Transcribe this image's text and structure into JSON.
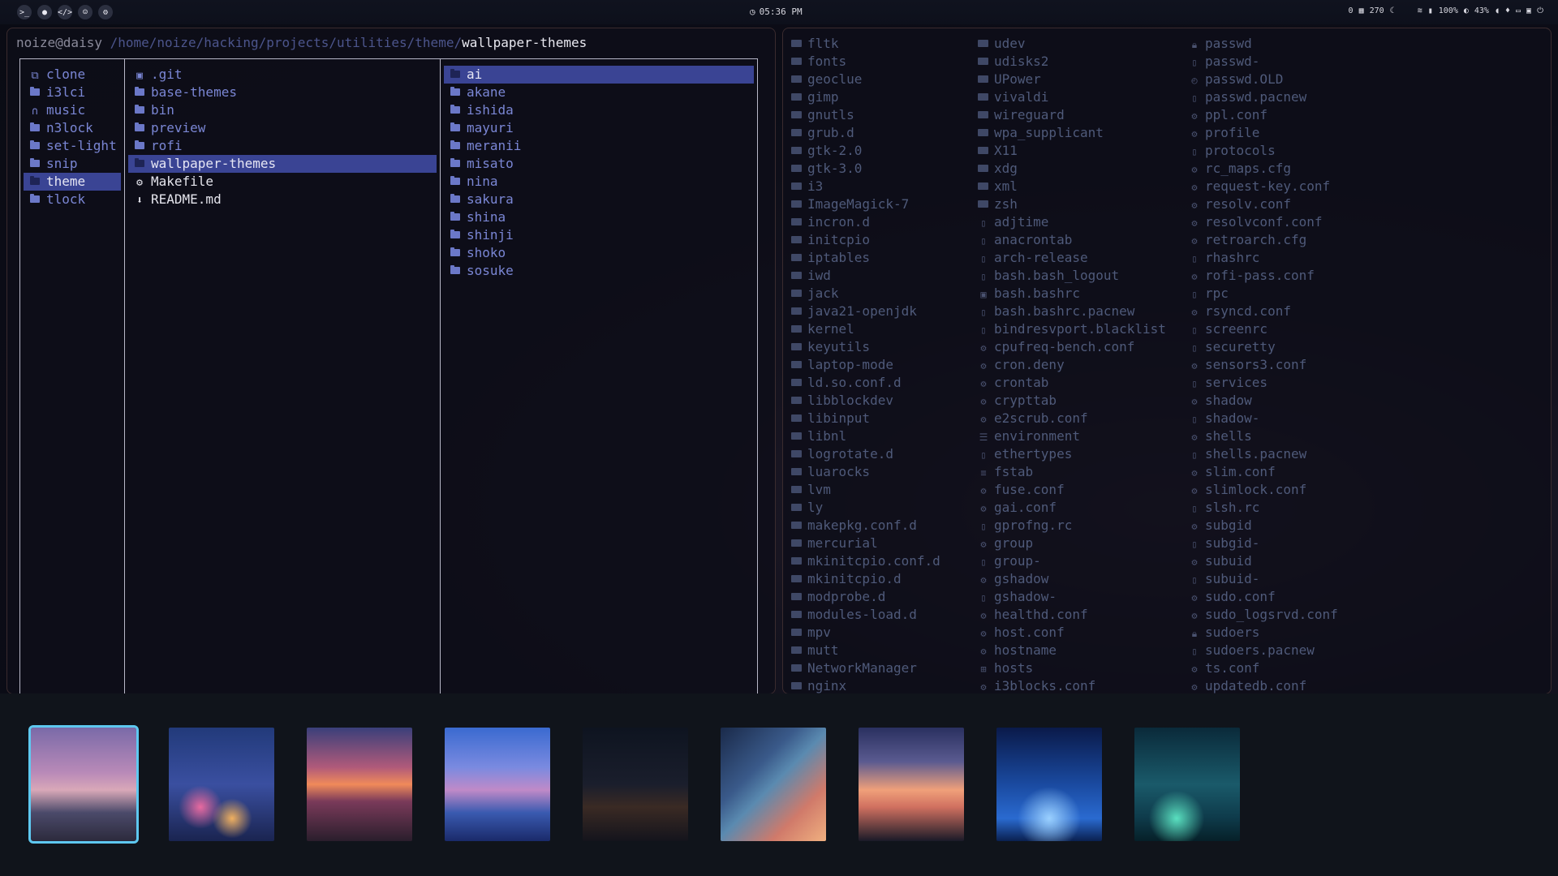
{
  "topbar": {
    "clock": "05:36 PM",
    "status": {
      "stat1": "0",
      "stat2": "270",
      "battery": "100%",
      "brightness": "43%"
    }
  },
  "terminal": {
    "prompt_user": "noize@daisy",
    "path_parent": "/home/noize/hacking/projects/utilities/theme/",
    "path_current": "wallpaper-themes"
  },
  "col1": {
    "items": [
      {
        "label": "clone",
        "icon": "copy-icon"
      },
      {
        "label": "i3lci",
        "icon": "folder-icon"
      },
      {
        "label": "music",
        "icon": "headphones-icon"
      },
      {
        "label": "n3lock",
        "icon": "folder-icon"
      },
      {
        "label": "set-light",
        "icon": "folder-icon"
      },
      {
        "label": "snip",
        "icon": "folder-icon"
      },
      {
        "label": "theme",
        "icon": "folder-icon",
        "selected": true
      },
      {
        "label": "tlock",
        "icon": "folder-icon"
      }
    ]
  },
  "col2": {
    "items": [
      {
        "label": ".git",
        "icon": "git-folder-icon"
      },
      {
        "label": "base-themes",
        "icon": "folder-icon"
      },
      {
        "label": "bin",
        "icon": "folder-icon"
      },
      {
        "label": "preview",
        "icon": "folder-icon"
      },
      {
        "label": "rofi",
        "icon": "folder-icon"
      },
      {
        "label": "wallpaper-themes",
        "icon": "folder-icon",
        "selected": true
      },
      {
        "label": "Makefile",
        "icon": "gear-icon",
        "file": true
      },
      {
        "label": "README.md",
        "icon": "markdown-icon",
        "file": true
      }
    ]
  },
  "col3": {
    "items": [
      {
        "label": "ai",
        "selected": true
      },
      {
        "label": "akane"
      },
      {
        "label": "ishida"
      },
      {
        "label": "mayuri"
      },
      {
        "label": "meranii"
      },
      {
        "label": "misato"
      },
      {
        "label": "nina"
      },
      {
        "label": "sakura"
      },
      {
        "label": "shina"
      },
      {
        "label": "shinji"
      },
      {
        "label": "shoko"
      },
      {
        "label": "sosuke"
      }
    ]
  },
  "etc_listing": {
    "col_a": [
      "fltk",
      "fonts",
      "geoclue",
      "gimp",
      "gnutls",
      "grub.d",
      "gtk-2.0",
      "gtk-3.0",
      "i3",
      "ImageMagick-7",
      "incron.d",
      "initcpio",
      "iptables",
      "iwd",
      "jack",
      "java21-openjdk",
      "kernel",
      "keyutils",
      "laptop-mode",
      "ld.so.conf.d",
      "libblockdev",
      "libinput",
      "libnl",
      "logrotate.d",
      "luarocks",
      "lvm",
      "ly",
      "makepkg.conf.d",
      "mercurial",
      "mkinitcpio.conf.d",
      "mkinitcpio.d",
      "modprobe.d",
      "modules-load.d",
      "mpv",
      "mutt",
      "NetworkManager",
      "nginx"
    ],
    "col_b": [
      {
        "t": "udev",
        "i": "folder"
      },
      {
        "t": "udisks2",
        "i": "folder"
      },
      {
        "t": "UPower",
        "i": "folder"
      },
      {
        "t": "vivaldi",
        "i": "folder"
      },
      {
        "t": "wireguard",
        "i": "folder"
      },
      {
        "t": "wpa_supplicant",
        "i": "folder"
      },
      {
        "t": "X11",
        "i": "folder"
      },
      {
        "t": "xdg",
        "i": "folder"
      },
      {
        "t": "xml",
        "i": "folder"
      },
      {
        "t": "zsh",
        "i": "folder"
      },
      {
        "t": "adjtime",
        "i": "file"
      },
      {
        "t": "anacrontab",
        "i": "file"
      },
      {
        "t": "arch-release",
        "i": "file"
      },
      {
        "t": "bash.bash_logout",
        "i": "file"
      },
      {
        "t": "bash.bashrc",
        "i": "term"
      },
      {
        "t": "bash.bashrc.pacnew",
        "i": "file"
      },
      {
        "t": "bindresvport.blacklist",
        "i": "file"
      },
      {
        "t": "cpufreq-bench.conf",
        "i": "gear"
      },
      {
        "t": "cron.deny",
        "i": "gear"
      },
      {
        "t": "crontab",
        "i": "gear"
      },
      {
        "t": "crypttab",
        "i": "gear"
      },
      {
        "t": "e2scrub.conf",
        "i": "gear"
      },
      {
        "t": "environment",
        "i": "lines"
      },
      {
        "t": "ethertypes",
        "i": "file"
      },
      {
        "t": "fstab",
        "i": "db"
      },
      {
        "t": "fuse.conf",
        "i": "gear"
      },
      {
        "t": "gai.conf",
        "i": "gear"
      },
      {
        "t": "gprofng.rc",
        "i": "file"
      },
      {
        "t": "group",
        "i": "gear"
      },
      {
        "t": "group-",
        "i": "file"
      },
      {
        "t": "gshadow",
        "i": "gear"
      },
      {
        "t": "gshadow-",
        "i": "file"
      },
      {
        "t": "healthd.conf",
        "i": "gear"
      },
      {
        "t": "host.conf",
        "i": "gear"
      },
      {
        "t": "hostname",
        "i": "gear"
      },
      {
        "t": "hosts",
        "i": "grid"
      },
      {
        "t": "i3blocks.conf",
        "i": "gear"
      }
    ],
    "col_c": [
      {
        "t": "passwd",
        "i": "lock"
      },
      {
        "t": "passwd-",
        "i": "file"
      },
      {
        "t": "passwd.OLD",
        "i": "clock"
      },
      {
        "t": "passwd.pacnew",
        "i": "file"
      },
      {
        "t": "ppl.conf",
        "i": "gear"
      },
      {
        "t": "profile",
        "i": "gear"
      },
      {
        "t": "protocols",
        "i": "file"
      },
      {
        "t": "rc_maps.cfg",
        "i": "gear"
      },
      {
        "t": "request-key.conf",
        "i": "gear"
      },
      {
        "t": "resolv.conf",
        "i": "gear"
      },
      {
        "t": "resolvconf.conf",
        "i": "gear"
      },
      {
        "t": "retroarch.cfg",
        "i": "gear"
      },
      {
        "t": "rhashrc",
        "i": "file"
      },
      {
        "t": "rofi-pass.conf",
        "i": "gear"
      },
      {
        "t": "rpc",
        "i": "file"
      },
      {
        "t": "rsyncd.conf",
        "i": "gear"
      },
      {
        "t": "screenrc",
        "i": "file"
      },
      {
        "t": "securetty",
        "i": "file"
      },
      {
        "t": "sensors3.conf",
        "i": "gear"
      },
      {
        "t": "services",
        "i": "file"
      },
      {
        "t": "shadow",
        "i": "gear"
      },
      {
        "t": "shadow-",
        "i": "file"
      },
      {
        "t": "shells",
        "i": "gear"
      },
      {
        "t": "shells.pacnew",
        "i": "file"
      },
      {
        "t": "slim.conf",
        "i": "gear"
      },
      {
        "t": "slimlock.conf",
        "i": "gear"
      },
      {
        "t": "slsh.rc",
        "i": "file"
      },
      {
        "t": "subgid",
        "i": "gear"
      },
      {
        "t": "subgid-",
        "i": "file"
      },
      {
        "t": "subuid",
        "i": "gear"
      },
      {
        "t": "subuid-",
        "i": "file"
      },
      {
        "t": "sudo.conf",
        "i": "gear"
      },
      {
        "t": "sudo_logsrvd.conf",
        "i": "gear"
      },
      {
        "t": "sudoers",
        "i": "lock"
      },
      {
        "t": "sudoers.pacnew",
        "i": "file"
      },
      {
        "t": "ts.conf",
        "i": "gear"
      },
      {
        "t": "updatedb.conf",
        "i": "gear"
      }
    ]
  },
  "thumbnails": [
    {
      "name": "thumb-1",
      "selected": true,
      "bg": "linear-gradient(180deg,#7a6aa8 0%,#b98ab8 40%,#d9a8b8 55%,#4b4a6a 75%,#2c2a3c 100%)"
    },
    {
      "name": "thumb-2",
      "bg": "radial-gradient(circle at 30% 70%,#e86aa0 0%,transparent 20%),radial-gradient(circle at 60% 80%,#f0b060 0%,transparent 18%),linear-gradient(180deg,#223a7a 0%,#3a4fa0 50%,#1a2450 100%)"
    },
    {
      "name": "thumb-3",
      "bg": "linear-gradient(180deg,#3a3f7a 0%,#b05a7a 35%,#f08a5a 50%,#7a3a5a 65%,#2a1e2c 100%)"
    },
    {
      "name": "thumb-4",
      "bg": "linear-gradient(180deg,#3a6ad0 0%,#7a8ae0 35%,#c08ac8 55%,#3a5ab0 75%,#1a2a6a 100%)"
    },
    {
      "name": "thumb-5",
      "bg": "linear-gradient(180deg,#0e1420 0%,#1a1e2c 50%,#3a2a24 70%,#14141c 100%)"
    },
    {
      "name": "thumb-6",
      "bg": "linear-gradient(135deg,#1a2a4a 0%,#3a5a8a 35%,#5a8ab0 50%,#d07a6a 75%,#f0b080 100%)"
    },
    {
      "name": "thumb-7",
      "bg": "linear-gradient(180deg,#2a3060 0%,#5a5a90 30%,#f0a07a 55%,#d07060 70%,#1a1a28 100%)"
    },
    {
      "name": "thumb-8",
      "bg": "radial-gradient(circle at 50% 80%,#9ad0ff 0%,transparent 30%),linear-gradient(180deg,#0a1a4a 0%,#1a4aa0 50%,#2a6ad0 80%,#0a2050 100%)"
    },
    {
      "name": "thumb-9",
      "bg": "radial-gradient(circle at 40% 80%,#5ae0c0 0%,transparent 25%),linear-gradient(180deg,#0a2a3a 0%,#1a5a6a 50%,#0e3a4a 80%,#062028 100%)"
    }
  ]
}
